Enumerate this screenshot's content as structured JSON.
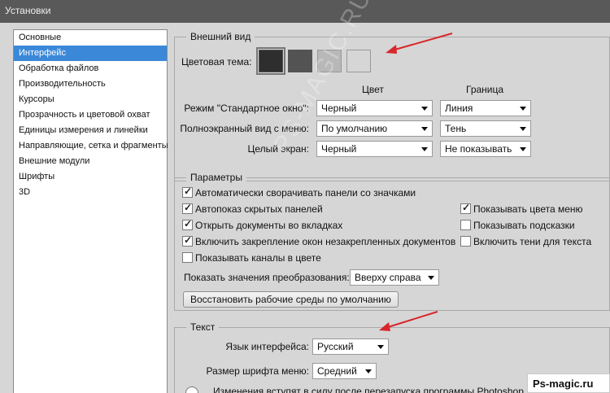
{
  "window": {
    "title": "Установки"
  },
  "nav": {
    "items": [
      "Основные",
      "Интерфейс",
      "Обработка файлов",
      "Производительность",
      "Курсоры",
      "Прозрачность и цветовой охват",
      "Единицы измерения и линейки",
      "Направляющие, сетка и фрагменты",
      "Внешние модули",
      "Шрифты",
      "3D"
    ],
    "selected": "Интерфейс"
  },
  "appearance": {
    "title": "Внешний вид",
    "color_theme_label": "Цветовая тема:",
    "swatch_colors": [
      "#2e2e2e",
      "#535353",
      "#b8b8b8",
      "#d6d6d6"
    ],
    "col_color": "Цвет",
    "col_border": "Граница",
    "rows": [
      {
        "label": "Режим \"Стандартное окно\":",
        "color": "Черный",
        "border": "Линия"
      },
      {
        "label": "Полноэкранный вид с меню:",
        "color": "По умолчанию",
        "border": "Тень"
      },
      {
        "label": "Целый экран:",
        "color": "Черный",
        "border": "Не показывать"
      }
    ]
  },
  "params": {
    "title": "Параметры",
    "left_checks": [
      {
        "label": "Автоматически сворачивать панели со значками",
        "checked": true
      },
      {
        "label": "Автопоказ скрытых панелей",
        "checked": true
      },
      {
        "label": "Открыть документы во вкладках",
        "checked": true
      },
      {
        "label": "Включить закрепление окон незакрепленных документов",
        "checked": true
      },
      {
        "label": "Показывать каналы в цвете",
        "checked": false
      }
    ],
    "right_checks": [
      {
        "label": "Показывать цвета меню",
        "checked": true
      },
      {
        "label": "Показывать подсказки",
        "checked": false
      },
      {
        "label": "Включить тени для текста",
        "checked": false
      }
    ],
    "transform_label": "Показать значения преобразования:",
    "transform_value": "Вверху справа",
    "restore_button": "Восстановить рабочие среды по умолчанию"
  },
  "text": {
    "title": "Текст",
    "language_label": "Язык интерфейса:",
    "language_value": "Русский",
    "font_size_label": "Размер шрифта меню:",
    "font_size_value": "Средний",
    "note": "Изменения вступят в силу после перезапуска программы Photoshop"
  },
  "watermark": "PS-MAGIC.RU",
  "site_badge": "Ps-magic.ru",
  "colors": {
    "selection": "#3b88d9",
    "arrow": "#d9262a"
  }
}
